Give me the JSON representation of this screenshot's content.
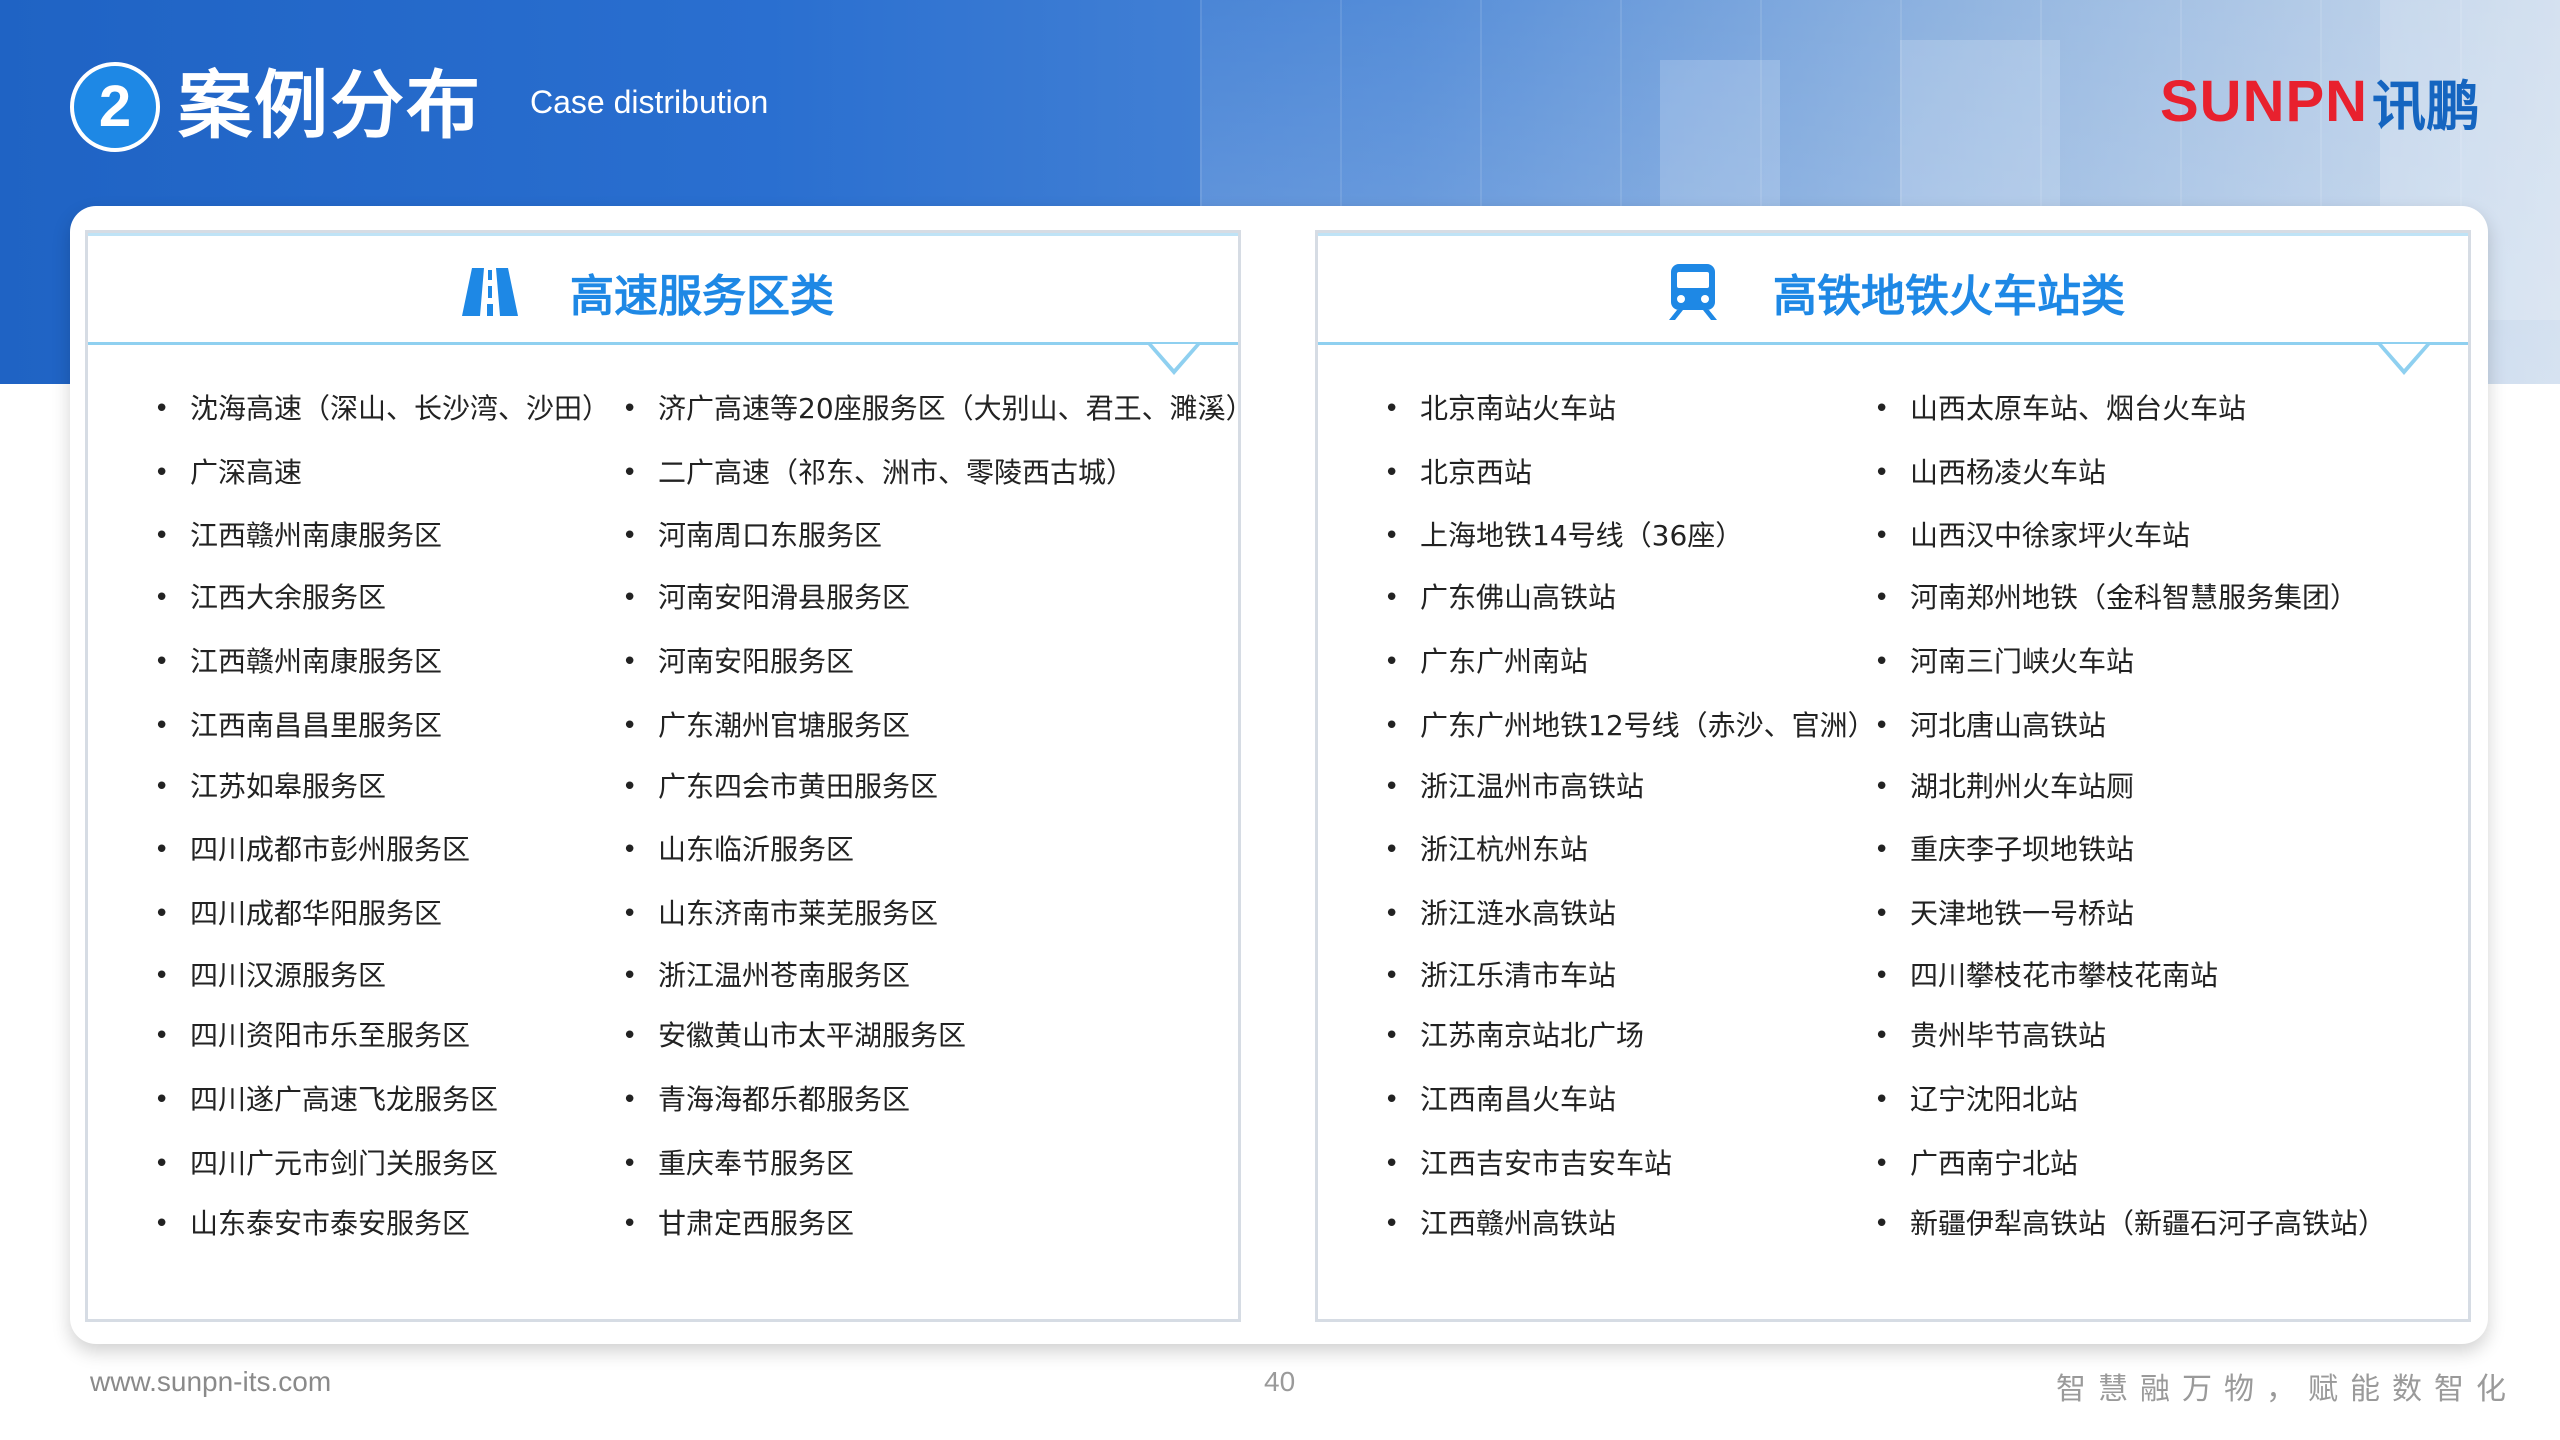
{
  "header": {
    "number": "2",
    "title_cn": "案例分布",
    "title_en": "Case distribution",
    "logo_en": "SUNPN",
    "logo_cn": "讯鹏"
  },
  "left_column": {
    "title": "高速服务区类",
    "icon": "highway-icon",
    "col1": [
      "沈海高速（深山、长沙湾、沙田）",
      "广深高速",
      "江西赣州南康服务区",
      "江西大余服务区",
      "江西赣州南康服务区",
      "江西南昌昌里服务区",
      "江苏如皋服务区",
      "四川成都市彭州服务区",
      "四川成都华阳服务区",
      "四川汉源服务区",
      "四川资阳市乐至服务区",
      "四川遂广高速飞龙服务区",
      "四川广元市剑门关服务区",
      "山东泰安市泰安服务区"
    ],
    "col2": [
      "济广高速等20座服务区（大别山、君王、濉溪）",
      "二广高速（祁东、洲市、零陵西古城）",
      "河南周口东服务区",
      "河南安阳滑县服务区",
      "河南安阳服务区",
      "广东潮州官塘服务区",
      "广东四会市黄田服务区",
      "山东临沂服务区",
      "山东济南市莱芜服务区",
      "浙江温州苍南服务区",
      "安徽黄山市太平湖服务区",
      "青海海都乐都服务区",
      "重庆奉节服务区",
      "甘肃定西服务区"
    ]
  },
  "right_column": {
    "title": "高铁地铁火车站类",
    "icon": "train-icon",
    "col1": [
      "北京南站火车站",
      "北京西站",
      "上海地铁14号线（36座）",
      "广东佛山高铁站",
      "广东广州南站",
      "广东广州地铁12号线（赤沙、官洲）",
      "浙江温州市高铁站",
      "浙江杭州东站",
      "浙江涟水高铁站",
      "浙江乐清市车站",
      "江苏南京站北广场",
      "江西南昌火车站",
      "江西吉安市吉安车站",
      "江西赣州高铁站"
    ],
    "col2": [
      "山西太原车站、烟台火车站",
      "山西杨凌火车站",
      "山西汉中徐家坪火车站",
      "河南郑州地铁（金科智慧服务集团）",
      "河南三门峡火车站",
      "河北唐山高铁站",
      "湖北荆州火车站厕",
      "重庆李子坝地铁站",
      "天津地铁一号桥站",
      "四川攀枝花市攀枝花南站",
      "贵州毕节高铁站",
      "辽宁沈阳北站",
      "广西南宁北站",
      "新疆伊犁高铁站（新疆石河子高铁站）"
    ]
  },
  "footer": {
    "url": "www.sunpn-its.com",
    "page": "40",
    "slogan": "智慧融万物，赋能数智化"
  },
  "colors": {
    "accent": "#1e88e5",
    "logo_red": "#e8212e",
    "banner": "#2a6fd0"
  }
}
